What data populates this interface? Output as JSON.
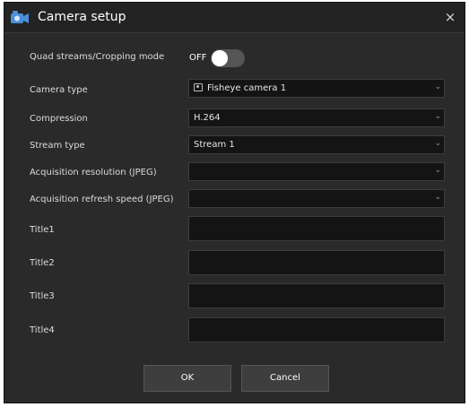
{
  "window": {
    "title": "Camera setup",
    "close_glyph": "×",
    "app_icon": "camera-app-icon",
    "close_icon": "close-icon"
  },
  "form": {
    "quad_streams": {
      "label": "Quad streams/Cropping mode",
      "state_text": "OFF"
    },
    "camera_type": {
      "label": "Camera type",
      "value": "Fisheye camera 1",
      "icon": "camera-icon"
    },
    "compression": {
      "label": "Compression",
      "value": "H.264"
    },
    "stream_type": {
      "label": "Stream type",
      "value": "Stream 1"
    },
    "acquisition_resolution": {
      "label": "Acquisition resolution (JPEG)",
      "value": ""
    },
    "acquisition_refresh": {
      "label": "Acquisition refresh speed (JPEG)",
      "value": ""
    },
    "titles": [
      {
        "label": "Title1",
        "value": ""
      },
      {
        "label": "Title2",
        "value": ""
      },
      {
        "label": "Title3",
        "value": ""
      },
      {
        "label": "Title4",
        "value": ""
      }
    ]
  },
  "buttons": {
    "ok": "OK",
    "cancel": "Cancel"
  },
  "colors": {
    "dialog_bg": "#2a2a2a",
    "field_bg": "#141414",
    "button_bg": "#3e3e3e",
    "accent_icon": "#4a90d9"
  }
}
